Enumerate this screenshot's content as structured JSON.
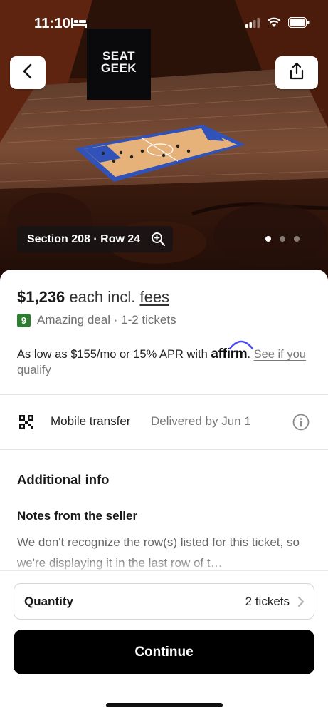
{
  "status_bar": {
    "time": "11:10"
  },
  "hero": {
    "brand_banner": "SEAT GEEK",
    "section_label": "Section 208 · Row 24",
    "carousel_dots": 3,
    "carousel_active": 0
  },
  "listing": {
    "price": "$1,236",
    "price_suffix": " each incl. ",
    "fees_label": "fees",
    "deal_score": "9",
    "deal_text": "Amazing deal · 1-2 tickets",
    "affirm_text": "As low as $155/mo or 15% APR with ",
    "affirm_logo": "affirm",
    "affirm_period": ". ",
    "affirm_link": "See if you qualify",
    "delivery_label": "Mobile transfer",
    "delivery_date": "Delivered by Jun 1",
    "additional_info_title": "Additional info",
    "notes_title": "Notes from the seller",
    "notes_text": "We don't recognize the row(s) listed for this ticket, so we're displaying it in the last row of t…"
  },
  "footer": {
    "quantity_label": "Quantity",
    "quantity_value": "2 tickets",
    "continue_label": "Continue"
  },
  "colors": {
    "deal_badge": "#2e7d32",
    "continue_bg": "#000000",
    "court": "#e6b27a",
    "court_border": "#3152b8"
  },
  "icons": [
    "bed-icon",
    "signal-icon",
    "wifi-icon",
    "battery-icon",
    "back-arrow-icon",
    "share-icon",
    "zoom-in-icon",
    "qr-icon",
    "info-icon",
    "chevron-right-icon"
  ]
}
